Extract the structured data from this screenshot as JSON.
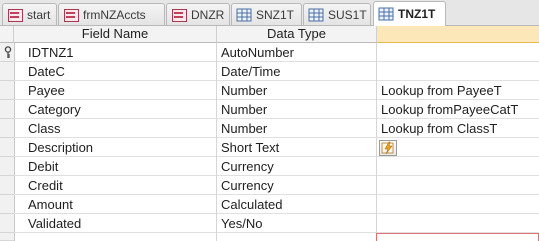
{
  "tabs": [
    {
      "label": "start",
      "kind": "form",
      "active": false
    },
    {
      "label": "frmNZAccts",
      "kind": "form",
      "active": false
    },
    {
      "label": "DNZR",
      "kind": "form",
      "active": false
    },
    {
      "label": "SNZ1T",
      "kind": "table",
      "active": false
    },
    {
      "label": "SUS1T",
      "kind": "table",
      "active": false
    },
    {
      "label": "TNZ1T",
      "kind": "table",
      "active": true
    }
  ],
  "grid": {
    "headers": {
      "field_name": "Field Name",
      "data_type": "Data Type",
      "description": ""
    },
    "rows": [
      {
        "field": "IDTNZ1",
        "type": "AutoNumber",
        "desc": "",
        "primary_key": true
      },
      {
        "field": "DateC",
        "type": "Date/Time",
        "desc": ""
      },
      {
        "field": "Payee",
        "type": "Number",
        "desc": "Lookup from PayeeT"
      },
      {
        "field": "Category",
        "type": "Number",
        "desc": "Lookup fromPayeeCatT"
      },
      {
        "field": "Class",
        "type": "Number",
        "desc": "Lookup from ClassT"
      },
      {
        "field": "Description",
        "type": "Short Text",
        "desc": ""
      },
      {
        "field": "Debit",
        "type": "Currency",
        "desc": ""
      },
      {
        "field": "Credit",
        "type": "Currency",
        "desc": ""
      },
      {
        "field": "Amount",
        "type": "Calculated",
        "desc": ""
      },
      {
        "field": "Validated",
        "type": "Yes/No",
        "desc": ""
      }
    ]
  },
  "colors": {
    "header_selected": "#fbe7b8",
    "form_icon": "#c1405a",
    "table_icon": "#4a6fa5"
  }
}
